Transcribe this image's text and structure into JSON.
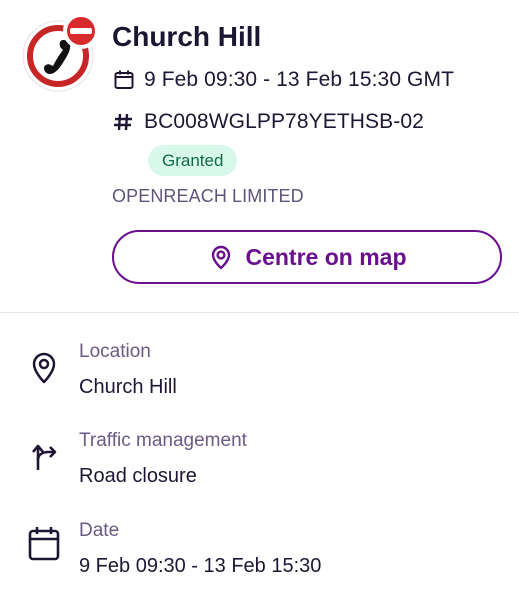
{
  "works": {
    "icon": "road-closure-telecom-icon",
    "title": "Church Hill",
    "dates": {
      "icon": "calendar-icon",
      "text": "9 Feb 09:30 - 13 Feb 15:30 GMT"
    },
    "reference": {
      "icon": "hash-icon",
      "text": "BC008WGLPP78YETHSB-02"
    },
    "status": {
      "label": "Granted",
      "background": "#d8f8ec",
      "color": "#136b45"
    },
    "promoter": "OPENREACH LIMITED",
    "centre_button": {
      "icon": "map-pin-icon",
      "label": "Centre on map",
      "color": "#6a0f8e"
    }
  },
  "details": {
    "location": {
      "icon": "location-pin-icon",
      "label": "Location",
      "value": "Church Hill"
    },
    "traffic": {
      "icon": "traffic-divert-icon",
      "label": "Traffic management",
      "value": "Road closure"
    },
    "date": {
      "icon": "calendar-icon",
      "label": "Date",
      "value": "9 Feb 09:30 - 13 Feb 15:30"
    }
  },
  "colors": {
    "brand": "#6a0f8e",
    "text_primary": "#1f1634",
    "text_secondary": "#6a5a84",
    "warning_red": "#d72a2a"
  }
}
